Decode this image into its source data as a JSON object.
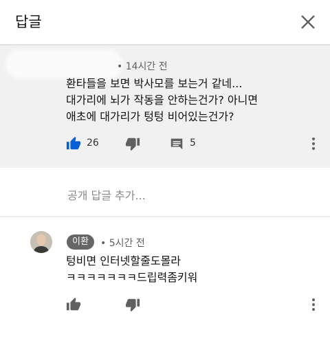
{
  "header": {
    "title": "답글",
    "close_icon": "close-icon"
  },
  "main_comment": {
    "time_text": "• 14시간 전",
    "lines": [
      "환타들을 보면 박사모를 보는거 같네...",
      "대가리에 뇌가 작동을 안하는건가? 아니면",
      "애초에 대가리가 텅텅 비어있는건가?"
    ],
    "like_count": "26",
    "reply_count": "5"
  },
  "reply_input": {
    "placeholder": "공개 답글 추가..."
  },
  "reply": {
    "author": "이환",
    "time_text": "• 5시간 전",
    "lines": [
      "텅비면 인터넷할줄도몰라",
      "ㅋㅋㅋㅋㅋㅋㅋ드립력좀키워"
    ]
  },
  "colors": {
    "main_bg": "#f1f1f1",
    "badge_bg": "#666666",
    "icon": "#606060",
    "like_active": "#065fd4"
  }
}
